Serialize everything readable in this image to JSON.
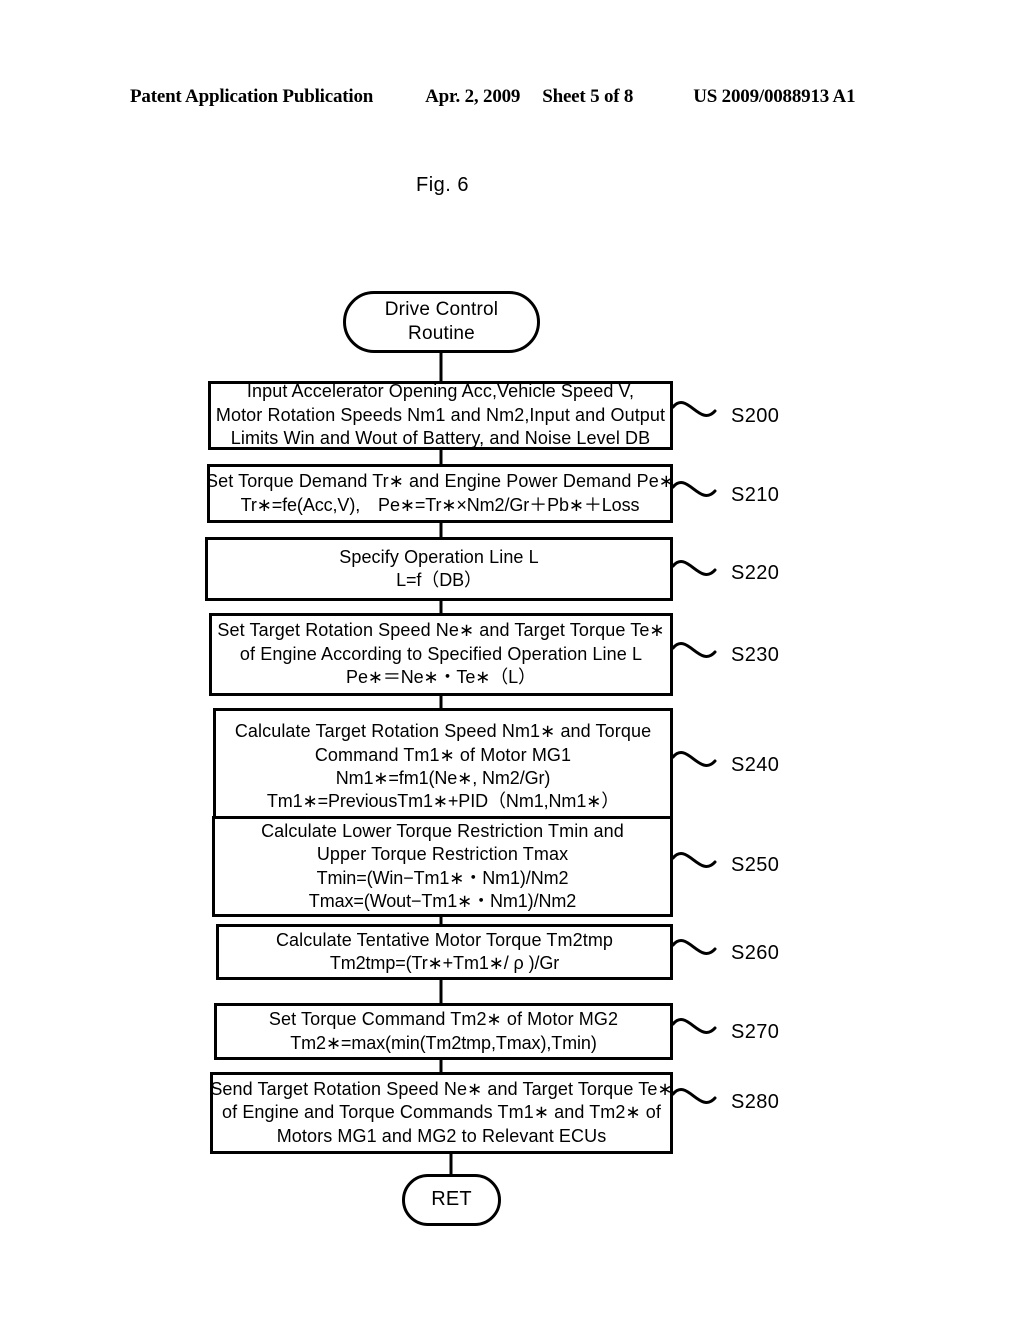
{
  "header": {
    "publication": "Patent Application Publication",
    "date": "Apr. 2, 2009",
    "sheet": "Sheet 5 of 8",
    "patent_number": "US 2009/0088913 A1"
  },
  "figure": {
    "label": "Fig. 6"
  },
  "flowchart": {
    "start": {
      "line1": "Drive Control",
      "line2": "Routine"
    },
    "end": {
      "label": "RET"
    },
    "steps": [
      {
        "id": "S200",
        "lines": [
          "Input Accelerator Opening Acc,Vehicle Speed V,",
          "Motor Rotation Speeds Nm1 and Nm2,Input and Output",
          "Limits Win and Wout of Battery, and Noise Level DB"
        ]
      },
      {
        "id": "S210",
        "lines": [
          "Set Torque Demand Tr∗ and Engine Power Demand Pe∗",
          "Tr∗=fe(Acc,V),　Pe∗=Tr∗×Nm2/Gr＋Pb∗＋Loss"
        ]
      },
      {
        "id": "S220",
        "lines": [
          "Specify Operation Line L",
          "L=f（DB）"
        ]
      },
      {
        "id": "S230",
        "lines": [
          "Set Target Rotation Speed Ne∗ and Target Torque Te∗",
          "of Engine According to Specified Operation Line L",
          "Pe∗＝Ne∗・Te∗（L）"
        ]
      },
      {
        "id": "S240",
        "lines": [
          "Calculate Target Rotation Speed Nm1∗ and Torque",
          "Command Tm1∗ of Motor MG1",
          "Nm1∗=fm1(Ne∗, Nm2/Gr)",
          "Tm1∗=PreviousTm1∗+PID（Nm1,Nm1∗）"
        ]
      },
      {
        "id": "S250",
        "lines": [
          "Calculate Lower Torque Restriction Tmin and",
          "Upper Torque Restriction Tmax",
          "Tmin=(Win−Tm1∗・Nm1)/Nm2",
          "Tmax=(Wout−Tm1∗・Nm1)/Nm2"
        ]
      },
      {
        "id": "S260",
        "lines": [
          "Calculate Tentative Motor Torque Tm2tmp",
          "Tm2tmp=(Tr∗+Tm1∗/ ρ )/Gr"
        ]
      },
      {
        "id": "S270",
        "lines": [
          "Set Torque Command Tm2∗ of Motor MG2",
          "Tm2∗=max(min(Tm2tmp,Tmax),Tmin)"
        ]
      },
      {
        "id": "S280",
        "lines": [
          "Send Target Rotation Speed Ne∗ and Target Torque Te∗",
          "of Engine and Torque Commands Tm1∗ and Tm2∗ of",
          "Motors MG1 and MG2 to Relevant ECUs"
        ]
      }
    ]
  },
  "colors": {
    "ink": "#000000",
    "paper": "#ffffff"
  }
}
